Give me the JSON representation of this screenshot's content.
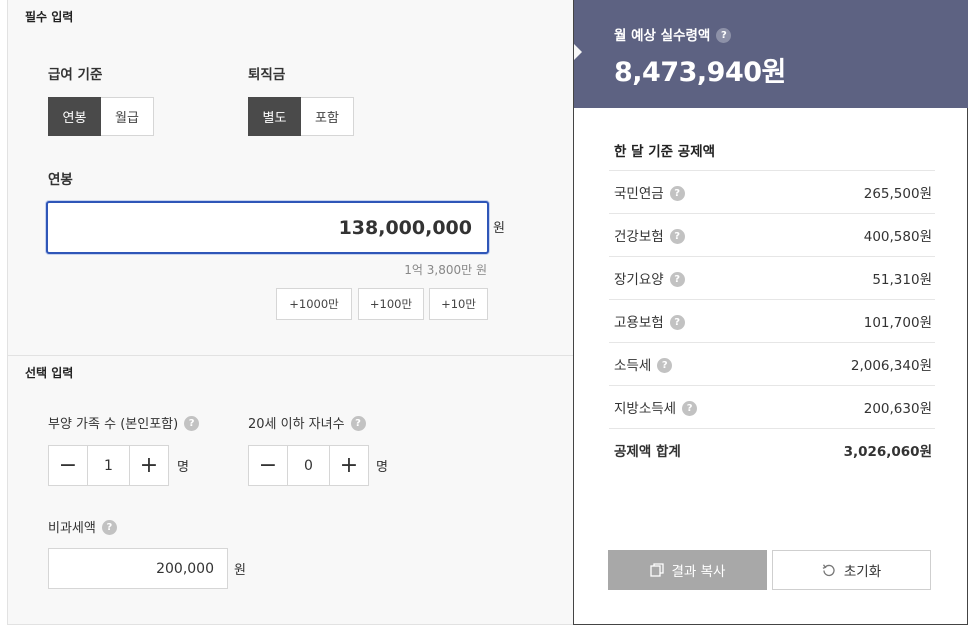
{
  "required": {
    "section_title": "필수 입력",
    "pay_basis": {
      "label": "급여 기준",
      "options": [
        "연봉",
        "월급"
      ],
      "selected": "연봉"
    },
    "severance": {
      "label": "퇴직금",
      "options": [
        "별도",
        "포함"
      ],
      "selected": "별도"
    },
    "salary": {
      "label": "연봉",
      "value": "138,000,000",
      "unit": "원",
      "hint": "1억 3,800만 원"
    },
    "quick_add": [
      "+1000만",
      "+100만",
      "+10만"
    ]
  },
  "optional": {
    "section_title": "선택 입력",
    "dependents": {
      "label": "부양 가족 수 (본인포함)",
      "value": "1",
      "unit": "명",
      "minus": "−",
      "plus": "+"
    },
    "children": {
      "label": "20세 이하 자녀수",
      "value": "0",
      "unit": "명",
      "minus": "−",
      "plus": "+"
    },
    "nontaxable": {
      "label": "비과세액",
      "value": "200,000",
      "unit": "원"
    }
  },
  "result": {
    "title": "월 예상 실수령액",
    "amount": "8,473,940원",
    "deduction_title": "한 달 기준 공제액",
    "deductions": [
      {
        "name": "국민연금",
        "value": "265,500원"
      },
      {
        "name": "건강보험",
        "value": "400,580원"
      },
      {
        "name": "장기요양",
        "value": "51,310원"
      },
      {
        "name": "고용보험",
        "value": "101,700원"
      },
      {
        "name": "소득세",
        "value": "2,006,340원"
      },
      {
        "name": "지방소득세",
        "value": "200,630원"
      }
    ],
    "total": {
      "name": "공제액 합계",
      "value": "3,026,060원"
    },
    "copy_label": "결과 복사",
    "reset_label": "초기화"
  },
  "help_glyph": "?",
  "colors": {
    "header_bg": "#5d6282",
    "selected_bg": "#4a4a4a",
    "focus_border": "#2f56b8",
    "copy_bg": "#a8a8a8"
  },
  "icons": [
    "help-icon",
    "copy-icon",
    "reset-icon"
  ]
}
